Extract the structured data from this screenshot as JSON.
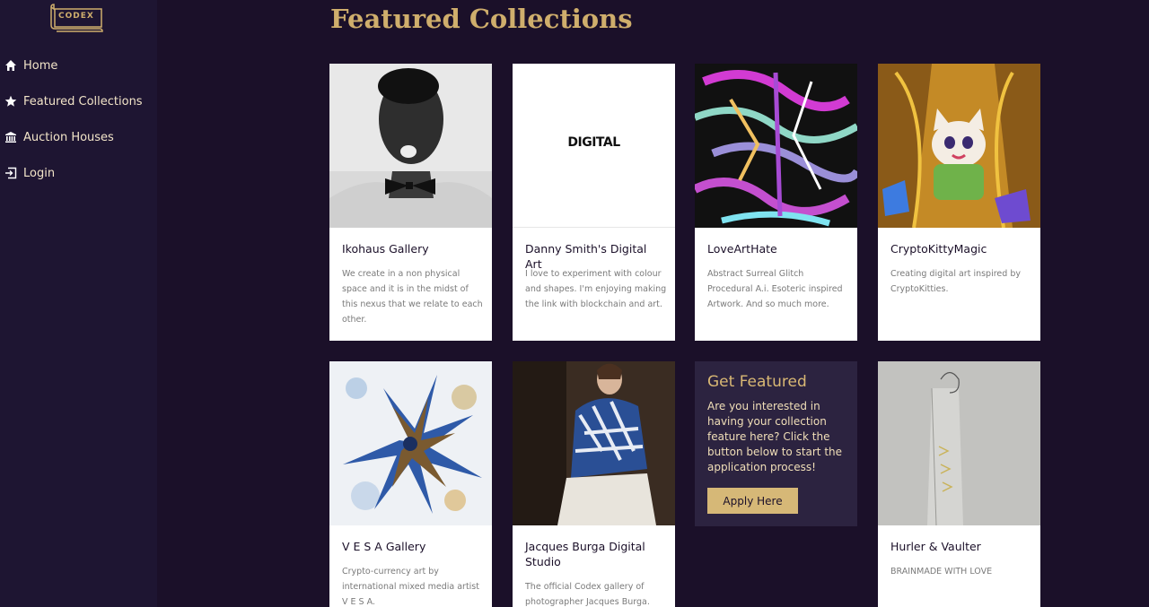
{
  "logo": {
    "text": "CODEX"
  },
  "sidebar": {
    "items": [
      {
        "label": "Home",
        "icon": "home-icon"
      },
      {
        "label": "Featured Collections",
        "icon": "star-icon"
      },
      {
        "label": "Auction Houses",
        "icon": "bank-icon"
      },
      {
        "label": "Login",
        "icon": "login-icon"
      }
    ]
  },
  "main": {
    "title": "Featured Collections",
    "cards": [
      {
        "title": "Ikohaus Gallery",
        "description": "We create in a non physical space and it is in the midst of this nexus that we relate to each other."
      },
      {
        "title": "Danny Smith's Digital Art",
        "description": "I love to experiment with colour and shapes. I'm enjoying making the link with blockchain and art.",
        "image_text": "DIGITAL"
      },
      {
        "title": "LoveArtHate",
        "description": "Abstract Surreal Glitch Procedural A.i. Esoteric inspired Artwork. And so much more."
      },
      {
        "title": "CryptoKittyMagic",
        "description": "Creating digital art inspired by CryptoKitties."
      },
      {
        "title": "V E S A Gallery",
        "description": "Crypto-currency art by international mixed media artist V E S A."
      },
      {
        "title": "Jacques Burga Digital Studio",
        "description": "The official Codex gallery of photographer Jacques Burga."
      },
      {
        "title": "Hurler & Vaulter",
        "description": "BRAINMADE WITH LOVE"
      }
    ],
    "feature": {
      "title": "Get Featured",
      "text": "Are you interested in having your collection feature here? Click the button below to start the application process!",
      "button_label": "Apply Here"
    }
  },
  "colors": {
    "background": "#1b1029",
    "sidebar": "#1e1532",
    "accent": "#cfae6c",
    "feature_box": "#2c2340"
  }
}
